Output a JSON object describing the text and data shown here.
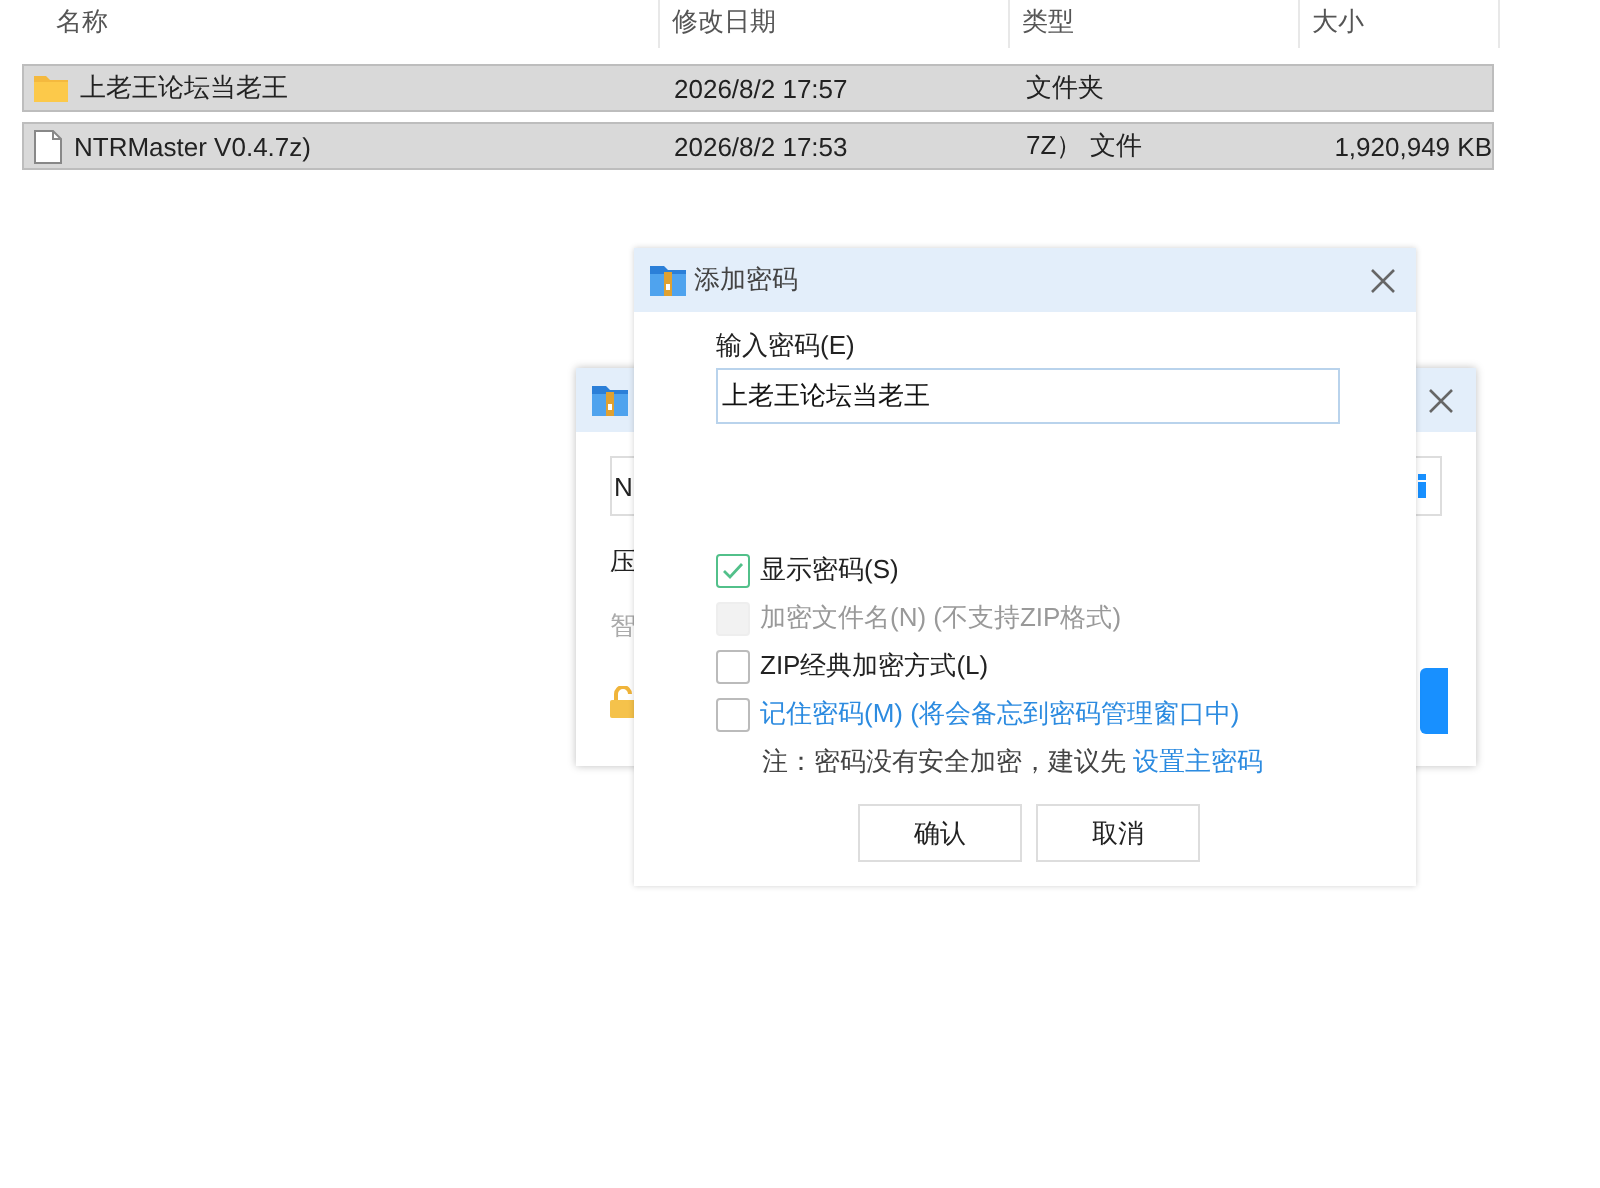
{
  "file_list": {
    "columns": [
      "名称",
      "修改日期",
      "类型",
      "大小"
    ],
    "rows": [
      {
        "kind": "folder",
        "name": "上老王论坛当老王",
        "modified": "2026/8/2 17:57",
        "type": "文件夹",
        "selected": true
      },
      {
        "kind": "file",
        "name": "NTRMaster V0.4.7z)",
        "modified": "2026/8/2 17:53",
        "type": "7Z） 文件",
        "size": "1,920,949 KB",
        "selected": true
      }
    ]
  },
  "background_dialog": {
    "field_value": "N",
    "label_1": "压",
    "label_2": "智"
  },
  "password_dialog": {
    "title": "添加密码",
    "field_label": "输入密码(E)",
    "value": "上老王论坛当老王",
    "options": [
      {
        "kind": "plain",
        "label": "显示密码(S)",
        "checked": true,
        "disabled": false
      },
      {
        "kind": "plain",
        "label": "加密文件名(N) (不支持ZIP格式)",
        "checked": false,
        "disabled": true
      },
      {
        "kind": "plain",
        "label": "ZIP经典加密方式(L)",
        "checked": false,
        "disabled": false
      },
      {
        "kind": "link",
        "label": "记住密码(M) (将会备忘到密码管理窗口中)",
        "checked": false,
        "disabled": false
      }
    ],
    "note": "注：密码没有安全加密，建议先",
    "note_link": "设置主密码",
    "buttons": [
      "确认",
      "取消"
    ]
  }
}
